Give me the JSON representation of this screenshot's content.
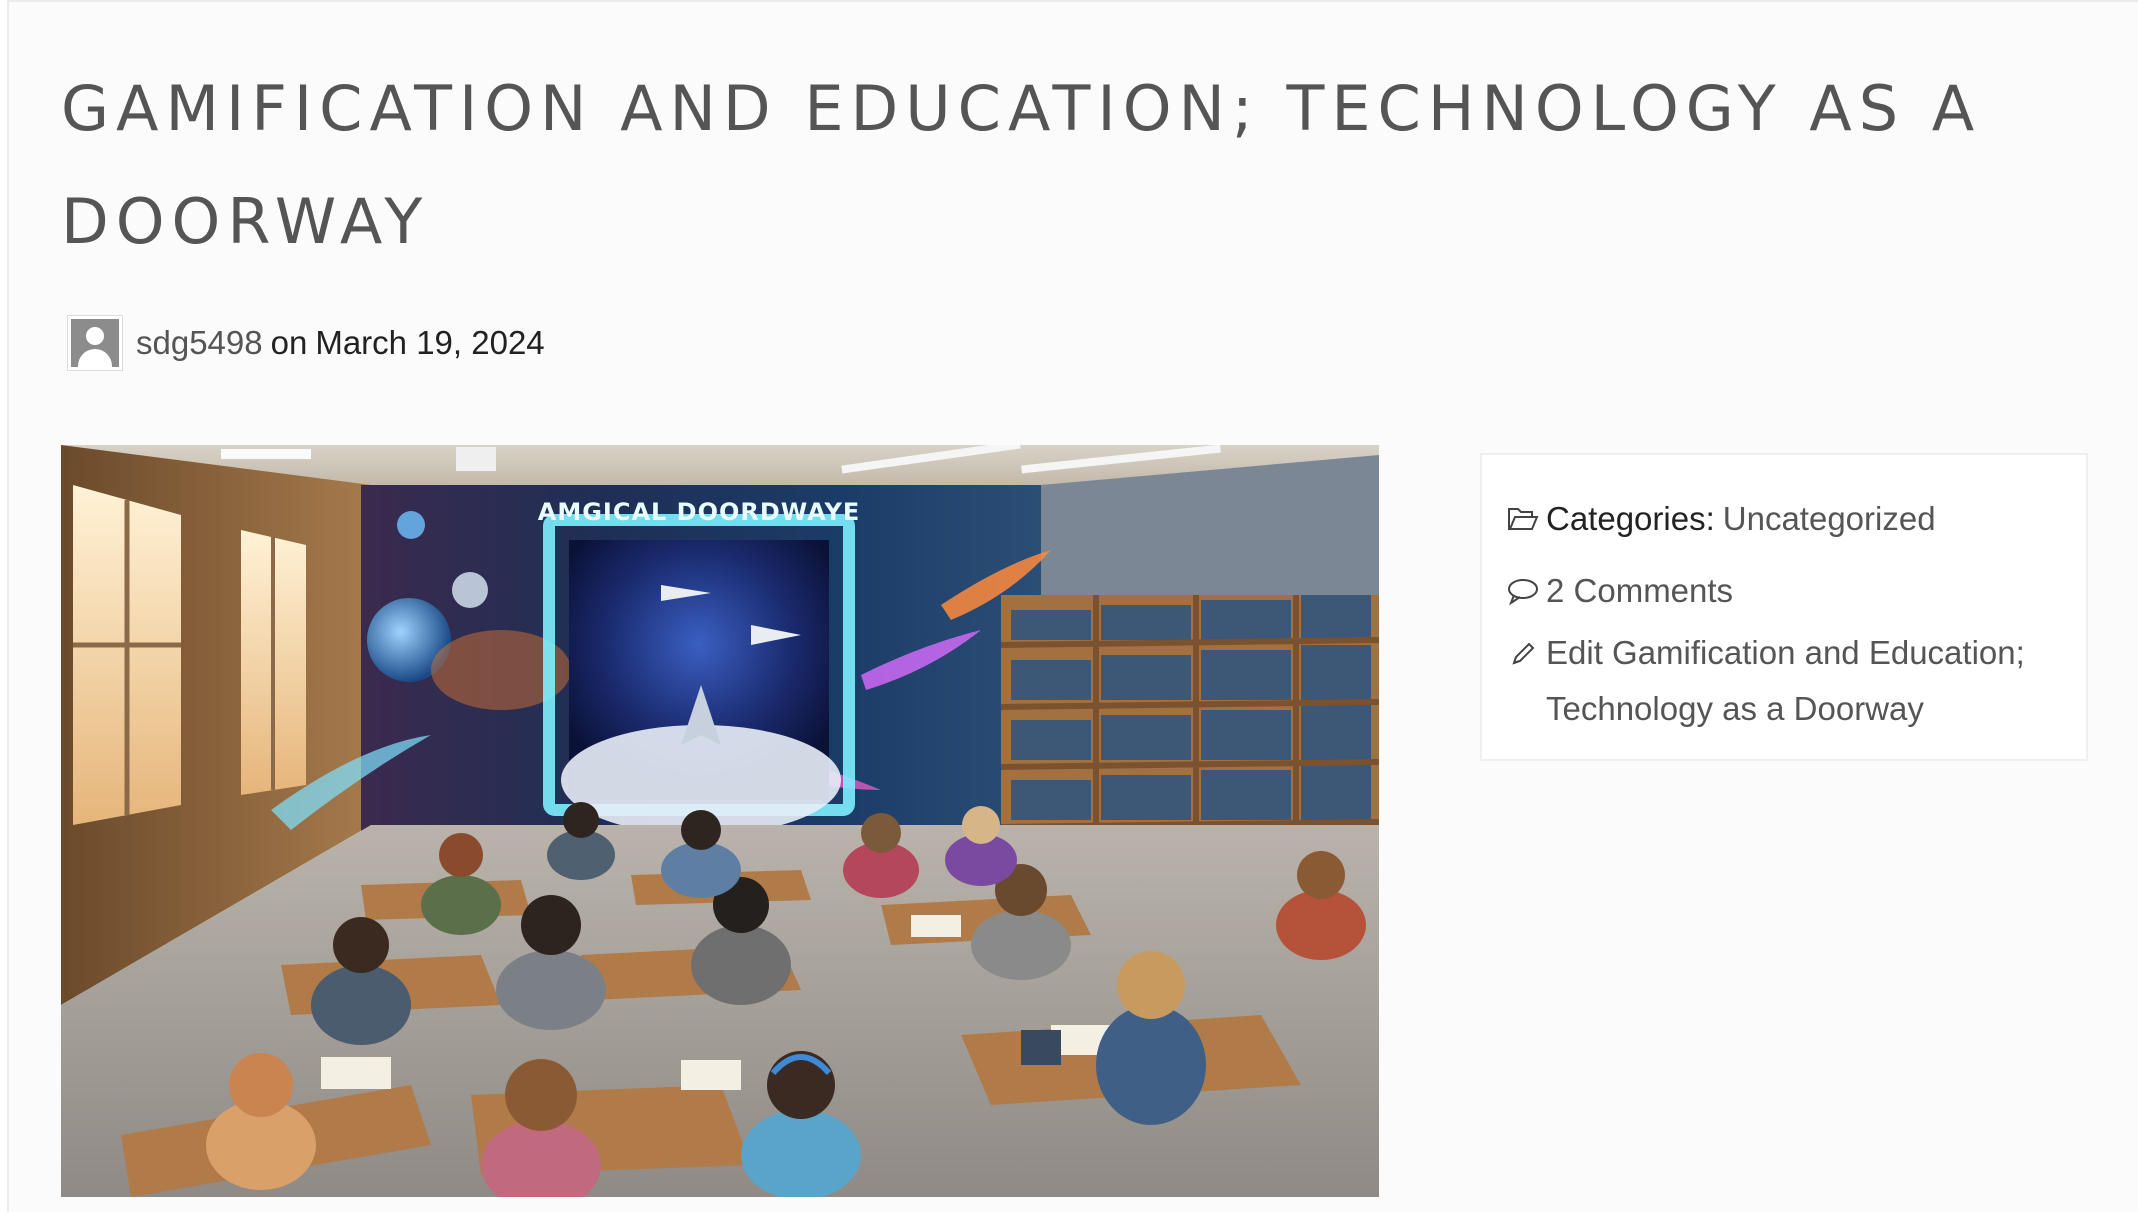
{
  "post": {
    "title": "GAMIFICATION AND EDUCATION; TECHNOLOGY AS A DOORWAY",
    "author": "sdg5498",
    "on_word": "on",
    "date": "March 19, 2024"
  },
  "featured_image": {
    "sign_text": "AMGICAL DOORDWAYE"
  },
  "sidebar": {
    "categories_label": "Categories:",
    "categories_value": "Uncategorized",
    "comments": "2 Comments",
    "edit_link": "Edit Gamification and Education; Technology as a Doorway"
  },
  "icons": {
    "avatar": "user-avatar-icon",
    "categories": "folder-open-icon",
    "comments": "speech-bubble-icon",
    "edit": "pencil-icon"
  }
}
